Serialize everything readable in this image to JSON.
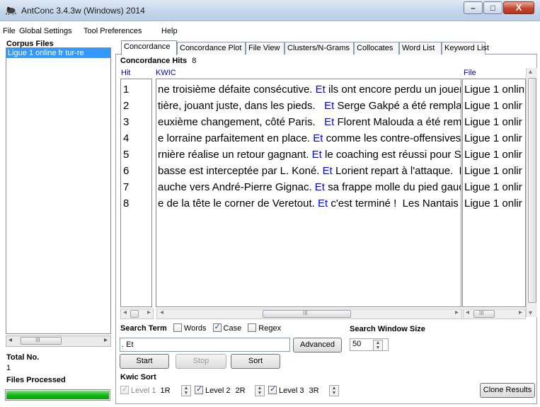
{
  "window": {
    "title": "AntConc 3.4.3w (Windows) 2014",
    "min_glyph": "–",
    "max_glyph": "□",
    "close_glyph": "X"
  },
  "menu": [
    "File",
    "Global Settings",
    "Tool Preferences",
    "Help"
  ],
  "left": {
    "corpus_files_label": "Corpus Files",
    "corpus_items": [
      "Ligue 1 online fr tur-re"
    ],
    "total_no_label": "Total No.",
    "total_no_value": "1",
    "files_processed_label": "Files Processed",
    "files_processed_fraction": 1.0
  },
  "tabs": [
    "Concordance",
    "Concordance Plot",
    "File View",
    "Clusters/N-Grams",
    "Collocates",
    "Word List",
    "Keyword List"
  ],
  "active_tab": "Concordance",
  "concordance": {
    "hits_label": "Concordance Hits",
    "hits_count": "8",
    "col_hit": "Hit",
    "col_kwic": "KWIC",
    "col_file": "File",
    "rows": [
      {
        "hit": "1",
        "left": "ne troisième défaite consécutive. ",
        "node": "Et",
        "right": " ils ont encore perdu un jouer",
        "file": "Ligue 1 onlin"
      },
      {
        "hit": "2",
        "left": "tière, jouant juste, dans les pieds.   ",
        "node": "Et",
        "right": " Serge Gakpé a été remplac",
        "file": "Ligue 1 onlir"
      },
      {
        "hit": "3",
        "left": "euxième changement, côté Paris.   ",
        "node": "Et",
        "right": " Florent Malouda a été rem",
        "file": "Ligue 1 onlir"
      },
      {
        "hit": "4",
        "left": "e lorraine parfaitement en place. ",
        "node": "Et",
        "right": " comme les contre-offensives",
        "file": "Ligue 1 onlir"
      },
      {
        "hit": "5",
        "left": "rnière réalise un retour gagnant. ",
        "node": "Et",
        "right": " le coaching est réussi pour S",
        "file": "Ligue 1 onlir"
      },
      {
        "hit": "6",
        "left": "basse est interceptée par L. Koné. ",
        "node": "Et",
        "right": " Lorient repart à l'attaque.  Fe",
        "file": "Ligue 1 onlir"
      },
      {
        "hit": "7",
        "left": "auche vers André-Pierre Gignac. ",
        "node": "Et",
        "right": " sa frappe molle du pied gauc",
        "file": "Ligue 1 onlir"
      },
      {
        "hit": "8",
        "left": "e de la tête le corner de Veretout. ",
        "node": "Et",
        "right": " c'est terminé !  Les Nantais je",
        "file": "Ligue 1 onlir"
      }
    ]
  },
  "search": {
    "label": "Search Term",
    "words_label": "Words",
    "words_checked": false,
    "case_label": "Case",
    "case_checked": true,
    "regex_label": "Regex",
    "regex_checked": false,
    "value": ". Et",
    "advanced_label": "Advanced",
    "window_size_label": "Search Window Size",
    "window_size_value": "50"
  },
  "buttons": {
    "start": "Start",
    "stop": "Stop",
    "sort": "Sort",
    "clone": "Clone Results"
  },
  "kwic_sort": {
    "label": "Kwic Sort",
    "level1_label": "Level 1",
    "level1_value": "1R",
    "level2_label": "Level 2",
    "level2_value": "2R",
    "level3_label": "Level 3",
    "level3_value": "3R"
  },
  "scroll_glyphs": {
    "left": "◂",
    "right": "▸",
    "up": "▴",
    "down": "▾",
    "grip": "III"
  }
}
